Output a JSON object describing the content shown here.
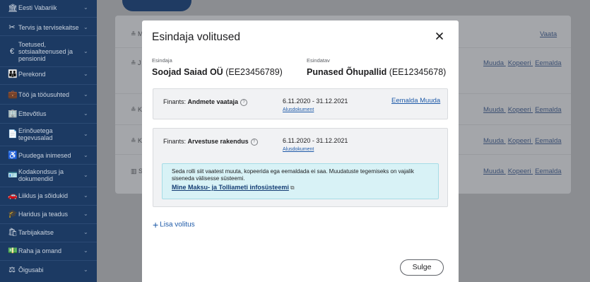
{
  "sidebar": {
    "items": [
      {
        "label": "Eesti Vabariik",
        "icon": "building-icon",
        "glyph": "🏛"
      },
      {
        "label": "Tervis ja tervisekaitse",
        "icon": "health-icon",
        "glyph": "✂"
      },
      {
        "label": "Toetused, sotsiaalteenused ja pensionid",
        "icon": "euro-icon",
        "glyph": "€"
      },
      {
        "label": "Perekond",
        "icon": "family-icon",
        "glyph": "👪"
      },
      {
        "label": "Töö ja tööusuhted",
        "icon": "briefcase-icon",
        "glyph": "💼"
      },
      {
        "label": "Ettevõtlus",
        "icon": "office-icon",
        "glyph": "🏢"
      },
      {
        "label": "Erinõuetega tegevusalad",
        "icon": "document-icon",
        "glyph": "📄"
      },
      {
        "label": "Puudega inimesed",
        "icon": "accessibility-icon",
        "glyph": "♿"
      },
      {
        "label": "Kodakondsus ja dokumendid",
        "icon": "id-card-icon",
        "glyph": "🪪"
      },
      {
        "label": "Liiklus ja sõidukid",
        "icon": "car-icon",
        "glyph": "🚗"
      },
      {
        "label": "Haridus ja teadus",
        "icon": "graduation-icon",
        "glyph": "🎓"
      },
      {
        "label": "Tarbijakaitse",
        "icon": "bag-icon",
        "glyph": "🛍"
      },
      {
        "label": "Raha ja omand",
        "icon": "money-icon",
        "glyph": "💵"
      },
      {
        "label": "Õigusabi",
        "icon": "scales-icon",
        "glyph": "⚖"
      }
    ]
  },
  "background": {
    "rows": [
      {
        "person": "M",
        "links": [
          "Vaata"
        ]
      },
      {
        "person": "J",
        "links": [
          "Muuda",
          "Kopeeri",
          "Eemalda"
        ]
      },
      {
        "person": "K",
        "links": [
          "Muuda",
          "Kopeeri",
          "Eemalda"
        ]
      },
      {
        "person": "K",
        "links": [
          "Muuda",
          "Kopeeri",
          "Eemalda"
        ]
      },
      {
        "person": "S",
        "links": [
          "Muuda",
          "Kopeeri",
          "Eemalda"
        ]
      }
    ]
  },
  "modal": {
    "title": "Esindaja volitused",
    "representative_label": "Esindaja",
    "representative_name": "Soojad Saiad OÜ",
    "representative_code": "(EE23456789)",
    "represented_label": "Esindatav",
    "represented_name": "Punased Õhupallid",
    "represented_code": "(EE12345678)",
    "roles": [
      {
        "prefix": "Finants:",
        "role": "Andmete vaataja",
        "dates": "6.11.2020 - 31.12.2021",
        "doc": "Alusdokument",
        "remove": "Eemalda",
        "edit": "Muuda"
      },
      {
        "prefix": "Finants:",
        "role": "Arvestuse rakendus",
        "dates": "6.11.2020 - 31.12.2021",
        "doc": "Alusdokument"
      }
    ],
    "info": {
      "text": "Seda rolli siit vaatest muuta, kopeerida ega eemaldada ei saa. Muudatuste tegemiseks on vajalik siseneda välisesse süsteemi.",
      "link": "Mine Maksu- ja Tolliameti infosüsteemi"
    },
    "add_label": "Lisa volitus",
    "close_label": "Sulge"
  },
  "colors": {
    "sidebar": "#1c3a63",
    "link": "#1e5aa8",
    "info_bg": "#d8f2f6"
  }
}
